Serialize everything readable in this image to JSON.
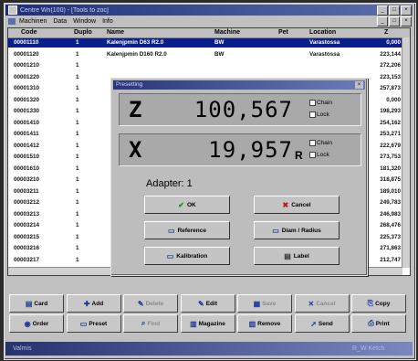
{
  "window": {
    "title": "Centre Wn(100) - [Tools to zoc]",
    "controls": [
      "_",
      "□",
      "×"
    ]
  },
  "menu": {
    "items": [
      "Machinen",
      "Data",
      "Window",
      "Info"
    ],
    "mdi_controls": [
      "_",
      "□",
      "×"
    ]
  },
  "list": {
    "columns": [
      "Code",
      "Duplo",
      "Name",
      "Machine",
      "Pet",
      "Location",
      "Z"
    ],
    "rows": [
      [
        "00001110",
        "1",
        "Kalenjpmin D63 R2.0",
        "BW",
        "",
        "Varastossa",
        "0,000"
      ],
      [
        "00001120",
        "1",
        "Kalenjpmin D160 R2.0",
        "BW",
        "",
        "Varastossa",
        "223,144"
      ],
      [
        "00001210",
        "1",
        "",
        "",
        "",
        "",
        "272,206"
      ],
      [
        "00001220",
        "1",
        "",
        "",
        "",
        "",
        "223,153"
      ],
      [
        "00001310",
        "1",
        "",
        "",
        "",
        "",
        "257,873"
      ],
      [
        "00001320",
        "1",
        "",
        "",
        "",
        "",
        "0,000"
      ],
      [
        "00001330",
        "1",
        "",
        "",
        "",
        "",
        "198,293"
      ],
      [
        "00001410",
        "1",
        "",
        "",
        "",
        "",
        "254,162"
      ],
      [
        "00001411",
        "1",
        "",
        "",
        "",
        "",
        "253,271"
      ],
      [
        "00001412",
        "1",
        "",
        "",
        "",
        "",
        "222,679"
      ],
      [
        "00001510",
        "1",
        "",
        "",
        "",
        "",
        "273,753"
      ],
      [
        "00001610",
        "1",
        "",
        "",
        "",
        "",
        "181,320"
      ],
      [
        "00003210",
        "1",
        "",
        "",
        "",
        "",
        "318,875"
      ],
      [
        "00003211",
        "1",
        "",
        "",
        "",
        "",
        "189,010"
      ],
      [
        "00003212",
        "1",
        "",
        "",
        "",
        "",
        "249,783"
      ],
      [
        "00003213",
        "1",
        "",
        "",
        "",
        "",
        "246,983"
      ],
      [
        "00003214",
        "1",
        "",
        "",
        "",
        "",
        "268,476"
      ],
      [
        "00003215",
        "1",
        "",
        "",
        "",
        "",
        "225,373"
      ],
      [
        "00003216",
        "1",
        "",
        "",
        "",
        "",
        "271,863"
      ],
      [
        "00003217",
        "1",
        "",
        "",
        "",
        "",
        "212,747"
      ]
    ]
  },
  "toolbar": {
    "row1": [
      {
        "label": "Card",
        "icon": "card-icon",
        "glyph": "▤",
        "enabled": true
      },
      {
        "label": "Add",
        "icon": "add-icon",
        "glyph": "✚",
        "enabled": true
      },
      {
        "label": "Delete",
        "icon": "delete-icon",
        "glyph": "✎",
        "enabled": false
      },
      {
        "label": "Edit",
        "icon": "edit-icon",
        "glyph": "✎",
        "enabled": true
      },
      {
        "label": "Save",
        "icon": "save-icon",
        "glyph": "▦",
        "enabled": false
      },
      {
        "label": "Cancel",
        "icon": "cancel-icon",
        "glyph": "✕",
        "enabled": false
      },
      {
        "label": "Copy",
        "icon": "copy-icon",
        "glyph": "⎘",
        "enabled": true
      }
    ],
    "row2": [
      {
        "label": "Order",
        "icon": "order-icon",
        "glyph": "◉",
        "enabled": true
      },
      {
        "label": "Preset",
        "icon": "preset-icon",
        "glyph": "▭",
        "enabled": true
      },
      {
        "label": "Find",
        "icon": "find-icon",
        "glyph": "⌕",
        "enabled": false
      },
      {
        "label": "Magazine",
        "icon": "magazine-icon",
        "glyph": "▥",
        "enabled": true
      },
      {
        "label": "Remove",
        "icon": "remove-icon",
        "glyph": "▥",
        "enabled": true
      },
      {
        "label": "Send",
        "icon": "send-icon",
        "glyph": "➚",
        "enabled": true
      },
      {
        "label": "Print",
        "icon": "print-icon",
        "glyph": "⎙",
        "enabled": true
      }
    ]
  },
  "status": {
    "left": "Valmis",
    "right": "R_W   Ketch"
  },
  "dialog": {
    "title": "Presetting",
    "z": {
      "label": "Z",
      "value": "100,567",
      "chain": "Chain",
      "lock": "Lock"
    },
    "x": {
      "label": "X",
      "value": "19,957",
      "suffix": "R",
      "chain": "Chain",
      "lock": "Lock"
    },
    "adapter": "Adapter: 1",
    "buttons": {
      "ok": "OK",
      "cancel": "Cancel",
      "reference": "Reference",
      "diam_radius": "Diam / Radius",
      "kalibration": "Kalibration",
      "label": "Label"
    },
    "button_icons": {
      "ok": "✔",
      "cancel": "✖",
      "reference": "▭",
      "diam_radius": "▭",
      "kalibration": "▭",
      "label": "▤"
    }
  }
}
